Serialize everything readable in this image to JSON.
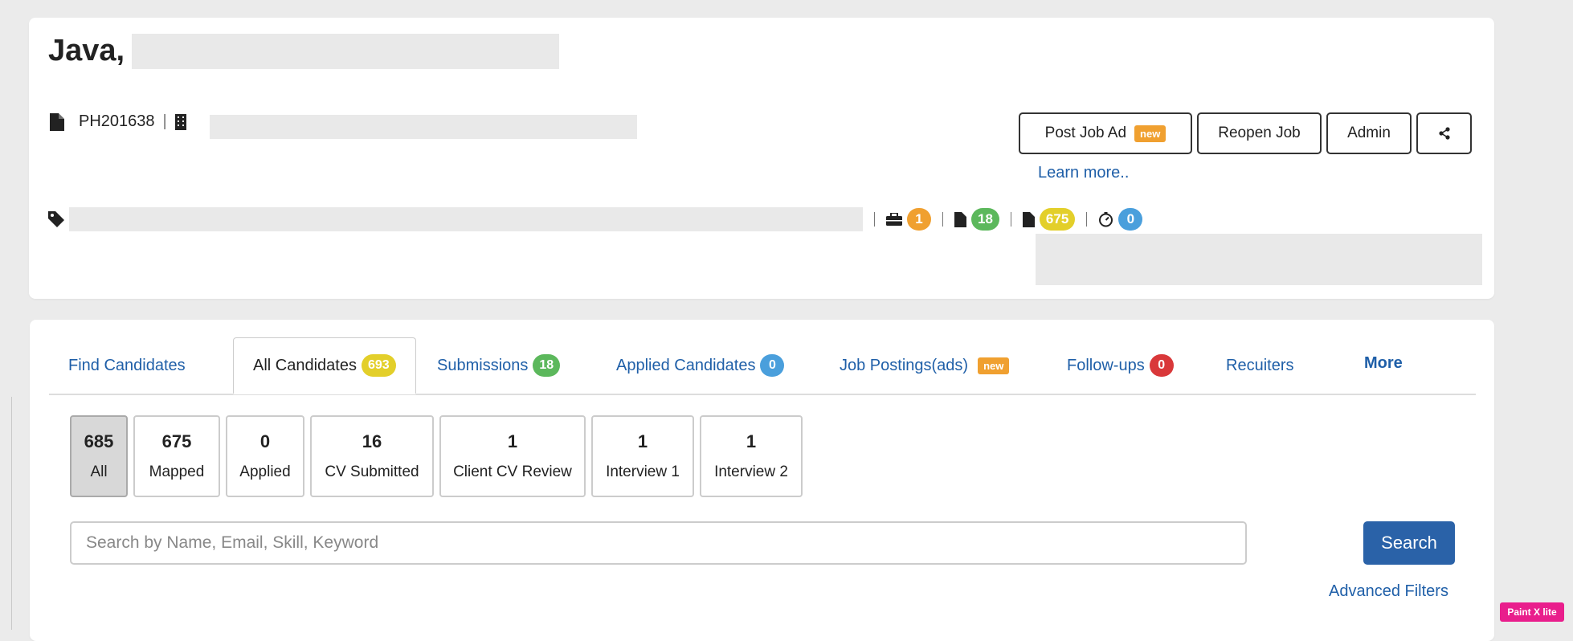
{
  "job": {
    "title": "Java,",
    "code": "PH201638",
    "separator": "|"
  },
  "actions": {
    "post_job_ad": "Post Job Ad",
    "post_job_ad_badge": "new",
    "reopen_job": "Reopen Job",
    "admin": "Admin",
    "learn_more": "Learn more.."
  },
  "stats": [
    {
      "icon": "briefcase-icon",
      "value": "1",
      "color": "#f0a030"
    },
    {
      "icon": "document-icon",
      "value": "18",
      "color": "#5cb85c"
    },
    {
      "icon": "document-icon",
      "value": "675",
      "color": "#e3cf2a"
    },
    {
      "icon": "stopwatch-icon",
      "value": "0",
      "color": "#4a9fdc"
    }
  ],
  "tabs": {
    "find_candidates": "Find Candidates",
    "all_candidates": "All Candidates",
    "all_candidates_count": "693",
    "submissions": "Submissions",
    "submissions_count": "18",
    "applied_candidates": "Applied Candidates",
    "applied_candidates_count": "0",
    "job_postings": "Job Postings(ads)",
    "job_postings_badge": "new",
    "follow_ups": "Follow-ups",
    "follow_ups_count": "0",
    "recruiters": "Recuiters",
    "more": "More"
  },
  "status_filters": [
    {
      "count": "685",
      "label": "All"
    },
    {
      "count": "675",
      "label": "Mapped"
    },
    {
      "count": "0",
      "label": "Applied"
    },
    {
      "count": "16",
      "label": "CV Submitted"
    },
    {
      "count": "1",
      "label": "Client CV Review"
    },
    {
      "count": "1",
      "label": "Interview 1"
    },
    {
      "count": "1",
      "label": "Interview 2"
    }
  ],
  "search": {
    "placeholder": "Search by Name, Email, Skill, Keyword",
    "button": "Search",
    "advanced_filters": "Advanced Filters"
  },
  "watermark": "Paint X lite",
  "colors": {
    "link": "#1f5fa8",
    "primary_button": "#2a62a8",
    "badge_orange": "#f0a030",
    "badge_green": "#5cb85c",
    "badge_yellow": "#e3cf2a",
    "badge_blue": "#4a9fdc",
    "badge_red": "#d9383a"
  }
}
